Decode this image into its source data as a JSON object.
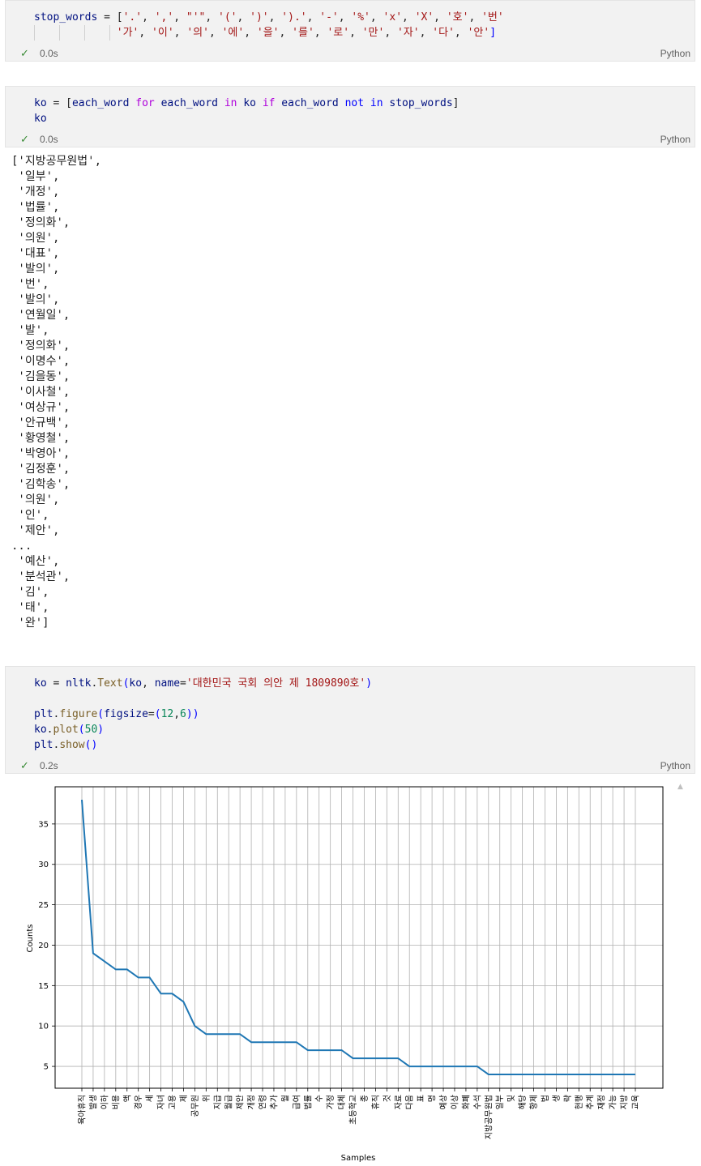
{
  "cells": [
    {
      "lines": [
        [
          {
            "t": "stop_words",
            "c": "var"
          },
          {
            "t": " = [",
            "c": ""
          },
          {
            "t": "'.'",
            "c": "str"
          },
          {
            "t": ", ",
            "c": ""
          },
          {
            "t": "','",
            "c": "str"
          },
          {
            "t": ", ",
            "c": ""
          },
          {
            "t": "\"'\"",
            "c": "str"
          },
          {
            "t": ", ",
            "c": ""
          },
          {
            "t": "'('",
            "c": "str"
          },
          {
            "t": ", ",
            "c": ""
          },
          {
            "t": "')'",
            "c": "str"
          },
          {
            "t": ", ",
            "c": ""
          },
          {
            "t": "').'",
            "c": "str"
          },
          {
            "t": ", ",
            "c": ""
          },
          {
            "t": "'-'",
            "c": "str"
          },
          {
            "t": ", ",
            "c": ""
          },
          {
            "t": "'%'",
            "c": "str"
          },
          {
            "t": ", ",
            "c": ""
          },
          {
            "t": "'x'",
            "c": "str"
          },
          {
            "t": ", ",
            "c": ""
          },
          {
            "t": "'X'",
            "c": "str"
          },
          {
            "t": ", ",
            "c": ""
          },
          {
            "t": "'호'",
            "c": "str"
          },
          {
            "t": ", ",
            "c": ""
          },
          {
            "t": "'번'",
            "c": "str"
          }
        ],
        [
          {
            "t": "             ",
            "c": ""
          },
          {
            "t": "'가'",
            "c": "str"
          },
          {
            "t": ", ",
            "c": ""
          },
          {
            "t": "'이'",
            "c": "str"
          },
          {
            "t": ", ",
            "c": ""
          },
          {
            "t": "'의'",
            "c": "str"
          },
          {
            "t": ", ",
            "c": ""
          },
          {
            "t": "'에'",
            "c": "str"
          },
          {
            "t": ", ",
            "c": ""
          },
          {
            "t": "'을'",
            "c": "str"
          },
          {
            "t": ", ",
            "c": ""
          },
          {
            "t": "'를'",
            "c": "str"
          },
          {
            "t": ", ",
            "c": ""
          },
          {
            "t": "'로'",
            "c": "str"
          },
          {
            "t": ", ",
            "c": ""
          },
          {
            "t": "'만'",
            "c": "str"
          },
          {
            "t": ", ",
            "c": ""
          },
          {
            "t": "'자'",
            "c": "str"
          },
          {
            "t": ", ",
            "c": ""
          },
          {
            "t": "'다'",
            "c": "str"
          },
          {
            "t": ", ",
            "c": ""
          },
          {
            "t": "'안'",
            "c": "str"
          },
          {
            "t": "]",
            "c": "blue"
          }
        ]
      ],
      "time": "0.0s",
      "lang": "Python"
    },
    {
      "lines": [
        [
          {
            "t": "ko",
            "c": "var"
          },
          {
            "t": " = [",
            "c": ""
          },
          {
            "t": "each_word",
            "c": "var"
          },
          {
            "t": " ",
            "c": ""
          },
          {
            "t": "for",
            "c": "kw"
          },
          {
            "t": " ",
            "c": ""
          },
          {
            "t": "each_word",
            "c": "var"
          },
          {
            "t": " ",
            "c": ""
          },
          {
            "t": "in",
            "c": "kw"
          },
          {
            "t": " ",
            "c": ""
          },
          {
            "t": "ko",
            "c": "var"
          },
          {
            "t": " ",
            "c": ""
          },
          {
            "t": "if",
            "c": "kw"
          },
          {
            "t": " ",
            "c": ""
          },
          {
            "t": "each_word",
            "c": "var"
          },
          {
            "t": " ",
            "c": ""
          },
          {
            "t": "not",
            "c": "blue"
          },
          {
            "t": " ",
            "c": ""
          },
          {
            "t": "in",
            "c": "blue"
          },
          {
            "t": " ",
            "c": ""
          },
          {
            "t": "stop_words",
            "c": "var"
          },
          {
            "t": "]",
            "c": ""
          }
        ],
        [
          {
            "t": "ko",
            "c": "var"
          }
        ]
      ],
      "time": "0.0s",
      "lang": "Python"
    },
    {
      "lines": [
        [
          {
            "t": "ko",
            "c": "var"
          },
          {
            "t": " = ",
            "c": ""
          },
          {
            "t": "nltk",
            "c": "var"
          },
          {
            "t": ".",
            "c": ""
          },
          {
            "t": "Text",
            "c": "fn"
          },
          {
            "t": "(",
            "c": "blue"
          },
          {
            "t": "ko",
            "c": "var"
          },
          {
            "t": ", ",
            "c": ""
          },
          {
            "t": "name",
            "c": "var"
          },
          {
            "t": "=",
            "c": ""
          },
          {
            "t": "'대한민국 국회 의안 제 1809890호'",
            "c": "str"
          },
          {
            "t": ")",
            "c": "blue"
          }
        ],
        [],
        [
          {
            "t": "plt",
            "c": "var"
          },
          {
            "t": ".",
            "c": ""
          },
          {
            "t": "figure",
            "c": "fn"
          },
          {
            "t": "(",
            "c": "blue"
          },
          {
            "t": "figsize",
            "c": "var"
          },
          {
            "t": "=",
            "c": ""
          },
          {
            "t": "(",
            "c": "blue"
          },
          {
            "t": "12",
            "c": "num"
          },
          {
            "t": ",",
            "c": ""
          },
          {
            "t": "6",
            "c": "num"
          },
          {
            "t": ")",
            "c": "blue"
          },
          {
            "t": ")",
            "c": "blue"
          }
        ],
        [
          {
            "t": "ko",
            "c": "var"
          },
          {
            "t": ".",
            "c": ""
          },
          {
            "t": "plot",
            "c": "fn"
          },
          {
            "t": "(",
            "c": "blue"
          },
          {
            "t": "50",
            "c": "num"
          },
          {
            "t": ")",
            "c": "blue"
          }
        ],
        [
          {
            "t": "plt",
            "c": "var"
          },
          {
            "t": ".",
            "c": ""
          },
          {
            "t": "show",
            "c": "fn"
          },
          {
            "t": "()",
            "c": "blue"
          }
        ]
      ],
      "time": "0.2s",
      "lang": "Python"
    }
  ],
  "output_text": "['지방공무원법',\n '일부',\n '개정',\n '법률',\n '정의화',\n '의원',\n '대표',\n '발의',\n '번',\n '발의',\n '연월일',\n '발',\n '정의화',\n '이명수',\n '김을동',\n '이사철',\n '여상규',\n '안규백',\n '황영철',\n '박영아',\n '김정훈',\n '김학송',\n '의원',\n '인',\n '제안',\n...\n '예산',\n '분석관',\n '김',\n '태',\n '완']",
  "chart_data": {
    "type": "line",
    "xlabel": "Samples",
    "ylabel": "Counts",
    "ylim": [
      2.3,
      39.6
    ],
    "yticks": [
      5,
      10,
      15,
      20,
      25,
      30,
      35
    ],
    "grid": true,
    "line_color": "#1f77b4",
    "categories": [
      "육아휴직",
      "발생",
      "이하",
      "비용",
      "액",
      "경우",
      "세",
      "자녀",
      "고용",
      "제",
      "공무원",
      "위",
      "지급",
      "월급",
      "제안",
      "개정",
      "연령",
      "추가",
      "월",
      "급여",
      "법률",
      "수",
      "가정",
      "대체",
      "초등학교",
      "종",
      "휴직",
      "것",
      "자료",
      "다음",
      "표",
      "명",
      "예상",
      "이상",
      "화폐",
      "수석",
      "지방공무원법",
      "일부",
      "및",
      "해당",
      "항제",
      "법",
      "생",
      "략",
      "현행",
      "추계",
      "재정",
      "가능",
      "지방",
      "교육"
    ],
    "values": [
      38,
      19,
      18,
      17,
      17,
      16,
      16,
      14,
      14,
      13,
      10,
      9,
      9,
      9,
      9,
      8,
      8,
      8,
      8,
      8,
      7,
      7,
      7,
      7,
      6,
      6,
      6,
      6,
      6,
      5,
      5,
      5,
      5,
      5,
      5,
      5,
      4,
      4,
      4,
      4,
      4,
      4,
      4,
      4,
      4,
      4,
      4,
      4,
      4,
      4
    ]
  }
}
